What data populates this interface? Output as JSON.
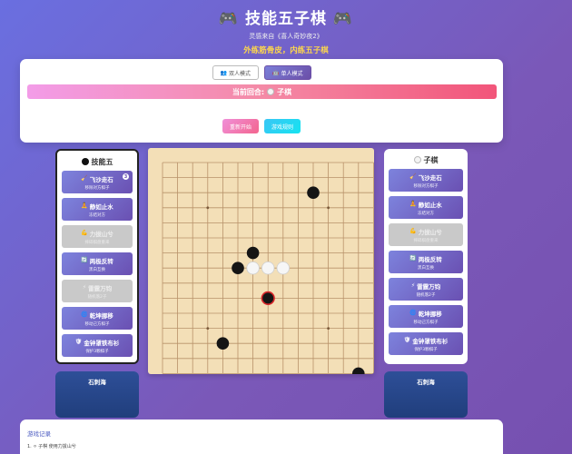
{
  "header": {
    "title_icon_left": "🎮",
    "title": "技能五子棋",
    "title_icon_right": "🎮",
    "subtitle": "灵感来自《喜人奇妙夜2》",
    "slogan": "外练筋骨皮，内练五子棋"
  },
  "modes": [
    {
      "icon": "👥",
      "label": "双人模式",
      "active": false
    },
    {
      "icon": "🤖",
      "label": "单人模式",
      "active": true
    }
  ],
  "turn": {
    "prefix": "当前回合:",
    "stone": "white",
    "label": "子棋"
  },
  "actions": {
    "restart": "重新开始",
    "rules": "游戏规则"
  },
  "players": {
    "left": {
      "title": "技能五",
      "stone": "black",
      "card_name": "石刺海",
      "skills": [
        {
          "icon": "🧹",
          "name": "飞沙走石",
          "desc": "移除对方棋子",
          "disabled": false,
          "badge": "3"
        },
        {
          "icon": "🧘",
          "name": "静如止水",
          "desc": "冻结对方",
          "disabled": false
        },
        {
          "icon": "💪",
          "name": "力拔山兮",
          "desc": "摔碎棋盘重来",
          "disabled": true
        },
        {
          "icon": "🔄",
          "name": "两极反转",
          "desc": "黑白互换",
          "disabled": false
        },
        {
          "icon": "⚡",
          "name": "雷霆万钧",
          "desc": "随机落2子",
          "disabled": true
        },
        {
          "icon": "🌀",
          "name": "乾坤挪移",
          "desc": "移动己方棋子",
          "disabled": false
        },
        {
          "icon": "🛡",
          "name": "金钟罩铁布衫",
          "desc": "保护3颗棋子",
          "disabled": false
        }
      ]
    },
    "right": {
      "title": "子棋",
      "stone": "white",
      "card_name": "石刺海",
      "skills": [
        {
          "icon": "🧹",
          "name": "飞沙走石",
          "desc": "移除对方棋子",
          "disabled": false
        },
        {
          "icon": "🧘",
          "name": "静如止水",
          "desc": "冻结对方",
          "disabled": false
        },
        {
          "icon": "💪",
          "name": "力拔山兮",
          "desc": "摔碎棋盘重来",
          "disabled": true
        },
        {
          "icon": "🔄",
          "name": "两极反转",
          "desc": "黑白互换",
          "disabled": false
        },
        {
          "icon": "⚡",
          "name": "雷霆万钧",
          "desc": "随机落2子",
          "disabled": false
        },
        {
          "icon": "🌀",
          "name": "乾坤挪移",
          "desc": "移动己方棋子",
          "disabled": false
        },
        {
          "icon": "🛡",
          "name": "金钟罩铁布衫",
          "desc": "保护3颗棋子",
          "disabled": false
        }
      ]
    }
  },
  "board": {
    "size": 15,
    "stones": [
      {
        "col": 10,
        "row": 2,
        "color": "black"
      },
      {
        "col": 6,
        "row": 6,
        "color": "black"
      },
      {
        "col": 5,
        "row": 7,
        "color": "black"
      },
      {
        "col": 6,
        "row": 7,
        "color": "white"
      },
      {
        "col": 7,
        "row": 7,
        "color": "white"
      },
      {
        "col": 8,
        "row": 7,
        "color": "white"
      },
      {
        "col": 7,
        "row": 9,
        "color": "black",
        "last": true
      },
      {
        "col": 4,
        "row": 12,
        "color": "black"
      },
      {
        "col": 13,
        "row": 14,
        "color": "black"
      }
    ],
    "star_points": [
      [
        3,
        3
      ],
      [
        11,
        3
      ],
      [
        7,
        7
      ],
      [
        3,
        11
      ],
      [
        11,
        11
      ]
    ],
    "colors": {
      "board": "#f3dfb7",
      "line": "#b8926a",
      "last_ring": "#d8262a"
    }
  },
  "log": {
    "title": "游戏记录",
    "entries": [
      "1. ⚪ 子棋 使用力拔山兮"
    ]
  }
}
